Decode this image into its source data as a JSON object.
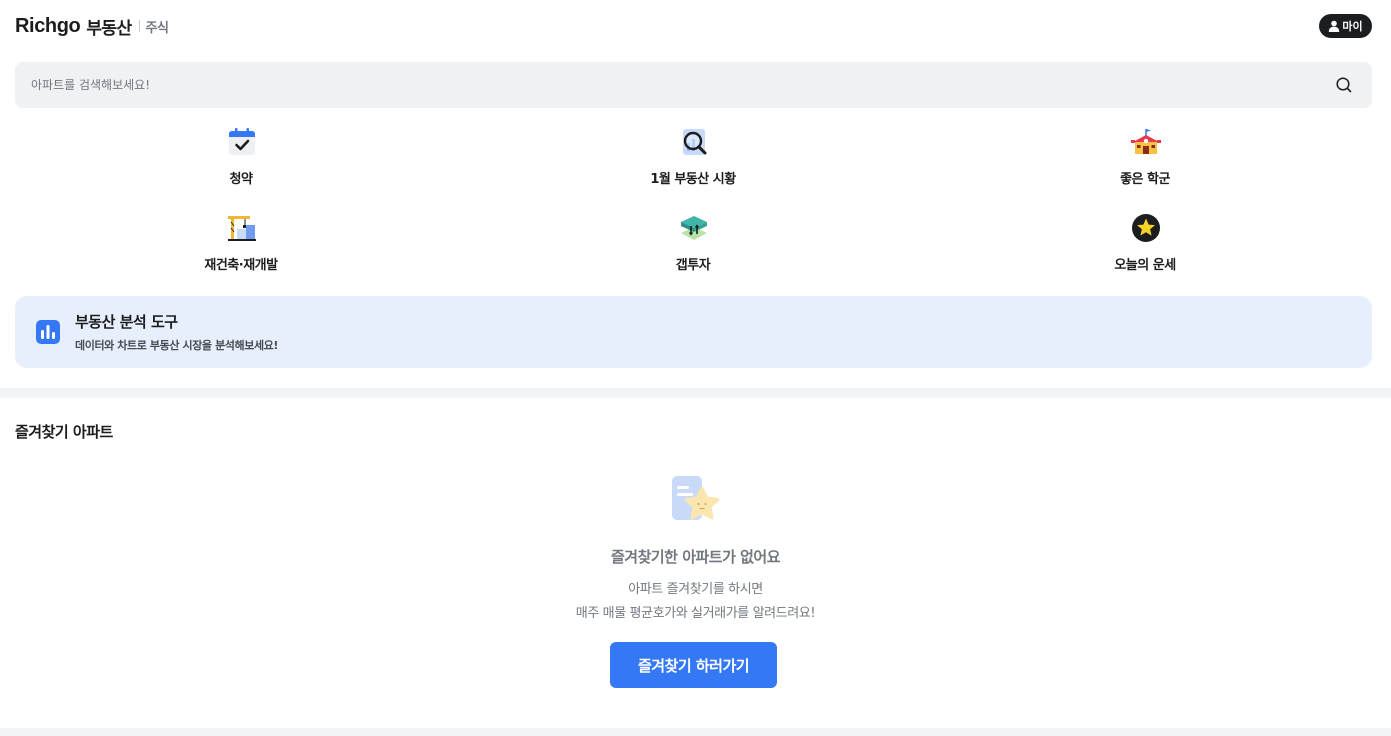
{
  "header": {
    "brand": "Richgo",
    "product": "부동산",
    "sub": "주식",
    "my_label": "마이"
  },
  "search": {
    "placeholder": "아파트를 검색해보세요!",
    "value": ""
  },
  "quick_menu": [
    {
      "label": "청약",
      "icon": "calendar-check-icon"
    },
    {
      "label": "1월 부동산 시황",
      "icon": "magnifier-chart-icon"
    },
    {
      "label": "좋은 학군",
      "icon": "school-icon"
    },
    {
      "label": "재건축·재개발",
      "icon": "crane-building-icon"
    },
    {
      "label": "갭투자",
      "icon": "gap-investment-icon"
    },
    {
      "label": "오늘의 운세",
      "icon": "star-fortune-icon"
    }
  ],
  "banner": {
    "title": "부동산 분석 도구",
    "desc": "데이터와 차트로 부동산 시장을 분석해보세요!",
    "icon": "bar-chart-icon"
  },
  "favorites": {
    "title": "즐겨찾기 아파트",
    "empty_title": "즐겨찾기한 아파트가 없어요",
    "empty_desc_1": "아파트 즐겨찾기를 하시면",
    "empty_desc_2": "매주 매물 평균호가와 실거래가를 알려드려요!",
    "cta_label": "즐겨찾기 하러가기",
    "illustration": "document-star-icon"
  },
  "colors": {
    "accent": "#3478f6",
    "banner_bg": "#e8effc",
    "search_bg": "#f0f1f3",
    "text_primary": "#1b1d1f",
    "text_secondary": "#72787f"
  }
}
